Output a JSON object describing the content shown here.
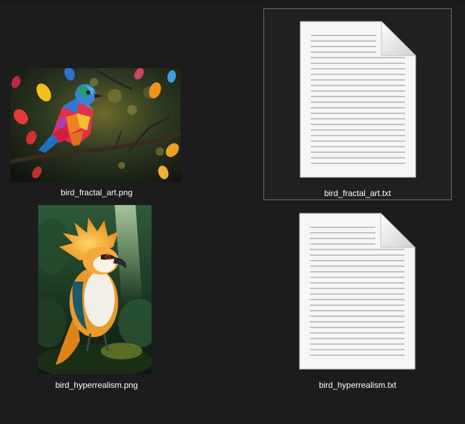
{
  "window": {
    "background": "#1c1c1c",
    "selection_border": "#6e6e6e"
  },
  "files": [
    {
      "name": "bird_fractal_art.png",
      "type": "image",
      "icon": "image-thumbnail-fractal-bird",
      "selected": false
    },
    {
      "name": "bird_fractal_art.txt",
      "type": "text",
      "icon": "text-document-icon",
      "selected": true
    },
    {
      "name": "bird_hyperrealism.png",
      "type": "image",
      "icon": "image-thumbnail-hyperreal-bird",
      "selected": false
    },
    {
      "name": "bird_hyperrealism.txt",
      "type": "text",
      "icon": "text-document-icon",
      "selected": false
    }
  ]
}
